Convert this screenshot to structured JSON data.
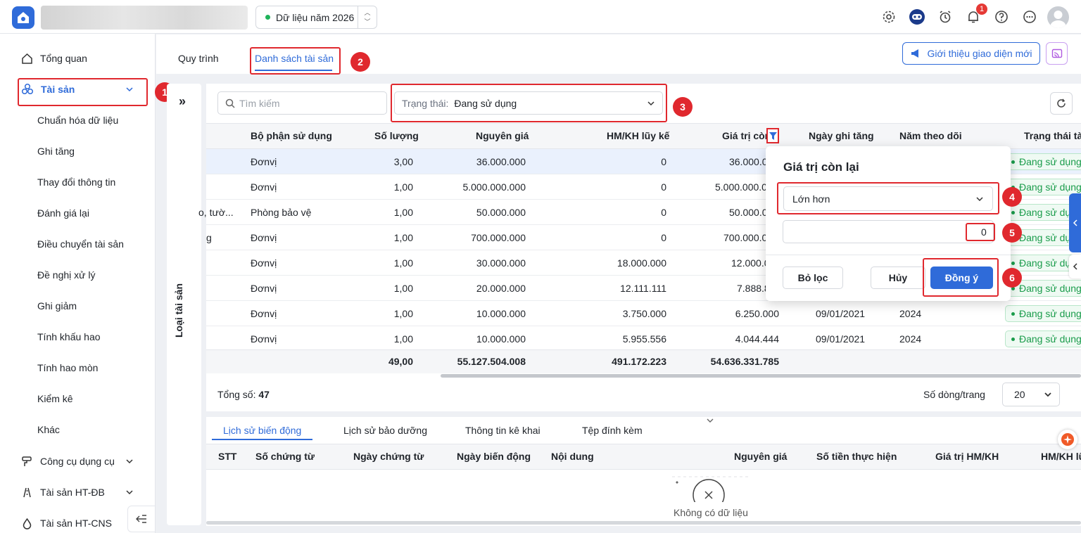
{
  "header": {
    "year_label": "Dữ liệu năm 2026",
    "notification_count": "1",
    "icons": [
      "settings-icon",
      "assistant-icon",
      "alarm-icon",
      "bell-icon",
      "help-icon",
      "more-icon",
      "avatar"
    ]
  },
  "sidebar": {
    "overview": "Tổng quan",
    "assets": "Tài sản",
    "sub_items": [
      "Chuẩn hóa dữ liệu",
      "Ghi tăng",
      "Thay đổi thông tin",
      "Đánh giá lại",
      "Điều chuyển tài sản",
      "Đề nghị xử lý",
      "Ghi giảm",
      "Tính khấu hao",
      "Tính hao mòn",
      "Kiểm kê",
      "Khác"
    ],
    "tools": "Công cụ dụng cụ",
    "infra": "Tài sản HT-ĐB",
    "cns": "Tài sản HT-CNS"
  },
  "tabs": {
    "process": "Quy trình",
    "asset_list": "Danh sách tài sản"
  },
  "intro_button": "Giới thiệu giao diện mới",
  "left_panel_label": "Loại tài sản",
  "expand_glyph": "»",
  "search_placeholder": "Tìm kiếm",
  "status_filter": {
    "label": "Trạng thái:",
    "value": "Đang sử dụng"
  },
  "table": {
    "columns": [
      "Bộ phận sử dụng",
      "Số lượng",
      "Nguyên giá",
      "HM/KH lũy kế",
      "Giá trị còn",
      "Ngày ghi tăng",
      "Năm theo dõi",
      "Trạng thái tài"
    ],
    "rows": [
      {
        "prefix": "",
        "dept": "Đơnvị",
        "qty": "3,00",
        "cost": "36.000.000",
        "acc": "0",
        "remain": "36.000.0",
        "date": "",
        "year": "",
        "status": "Đang sử dụng"
      },
      {
        "prefix": "",
        "dept": "Đơnvị",
        "qty": "1,00",
        "cost": "5.000.000.000",
        "acc": "0",
        "remain": "5.000.000.0",
        "date": "",
        "year": "",
        "status": "Đang sử dụng"
      },
      {
        "prefix": "o, tườ...",
        "dept": "Phòng bảo vệ",
        "qty": "1,00",
        "cost": "50.000.000",
        "acc": "0",
        "remain": "50.000.0",
        "date": "",
        "year": "",
        "status": "Đang sử dụng"
      },
      {
        "prefix": "g",
        "dept": "Đơnvị",
        "qty": "1,00",
        "cost": "700.000.000",
        "acc": "0",
        "remain": "700.000.0",
        "date": "",
        "year": "",
        "status": "Đang sử dụng"
      },
      {
        "prefix": "",
        "dept": "Đơnvị",
        "qty": "1,00",
        "cost": "30.000.000",
        "acc": "18.000.000",
        "remain": "12.000.0",
        "date": "",
        "year": "",
        "status": "Đang sử dụng"
      },
      {
        "prefix": "",
        "dept": "Đơnvị",
        "qty": "1,00",
        "cost": "20.000.000",
        "acc": "12.111.111",
        "remain": "7.888.8",
        "date": "",
        "year": "",
        "status": "Đang sử dụng"
      },
      {
        "prefix": "",
        "dept": "Đơnvị",
        "qty": "1,00",
        "cost": "10.000.000",
        "acc": "3.750.000",
        "remain": "6.250.000",
        "date": "09/01/2021",
        "year": "2024",
        "status": "Đang sử dụng"
      },
      {
        "prefix": "",
        "dept": "Đơnvị",
        "qty": "1,00",
        "cost": "10.000.000",
        "acc": "5.955.556",
        "remain": "4.044.444",
        "date": "09/01/2021",
        "year": "2024",
        "status": "Đang sử dụng"
      }
    ],
    "totals": {
      "qty": "49,00",
      "cost": "55.127.504.008",
      "acc": "491.172.223",
      "remain": "54.636.331.785"
    }
  },
  "footer": {
    "total_label": "Tổng số:",
    "total_value": "47",
    "rows_per_page_label": "Số dòng/trang",
    "rows_per_page": "20"
  },
  "bottom_tabs": [
    "Lịch sử biến động",
    "Lịch sử bảo dưỡng",
    "Thông tin kê khai",
    "Tệp đính kèm"
  ],
  "bottom_columns": [
    "STT",
    "Số chứng từ",
    "Ngày chứng từ",
    "Ngày biến động",
    "Nội dung",
    "Nguyên giá",
    "Số tiền thực hiện",
    "Giá trị HM/KH",
    "HM/KH lũ"
  ],
  "empty_text": "Không có dữ liệu",
  "filter_popup": {
    "title": "Giá trị còn lại",
    "operator": "Lớn hơn",
    "value": "0",
    "clear_button": "Bỏ lọc",
    "cancel_button": "Hủy",
    "ok_button": "Đồng ý"
  },
  "callouts": [
    "1",
    "2",
    "3",
    "4",
    "5",
    "6"
  ],
  "colors": {
    "accent": "#2f6bd9",
    "highlight": "#e0282e",
    "status_green": "#1a9c4b"
  }
}
